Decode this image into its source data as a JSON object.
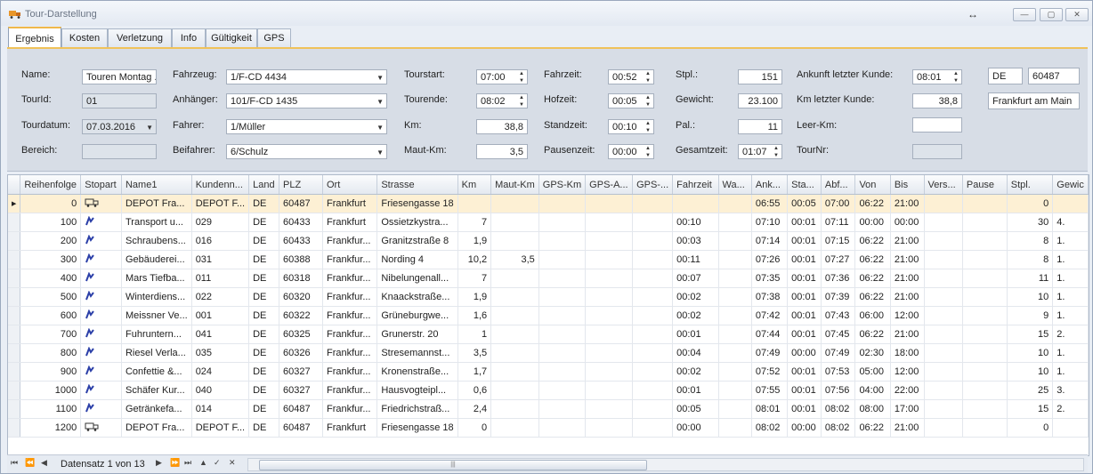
{
  "window": {
    "title": "Tour-Darstellung",
    "resize_glyph": "↔",
    "buttons": [
      "—",
      "▢",
      "✕"
    ]
  },
  "tabs": [
    "Ergebnis",
    "Kosten",
    "Verletzung",
    "Info",
    "Gültigkeit",
    "GPS"
  ],
  "form": {
    "name": {
      "label": "Name:",
      "value": "Touren Montag ..."
    },
    "tourid": {
      "label": "TourId:",
      "value": "01"
    },
    "tourdatum": {
      "label": "Tourdatum:",
      "value": "07.03.2016"
    },
    "bereich": {
      "label": "Bereich:",
      "value": ""
    },
    "fahrzeug": {
      "label": "Fahrzeug:",
      "value": "1/F-CD 4434"
    },
    "anhaenger": {
      "label": "Anhänger:",
      "value": "101/F-CD 1435"
    },
    "fahrer": {
      "label": "Fahrer:",
      "value": "1/Müller"
    },
    "beifahrer": {
      "label": "Beifahrer:",
      "value": "6/Schulz"
    },
    "tourstart": {
      "label": "Tourstart:",
      "value": "07:00"
    },
    "tourende": {
      "label": "Tourende:",
      "value": "08:02"
    },
    "km": {
      "label": "Km:",
      "value": "38,8"
    },
    "mautkm": {
      "label": "Maut-Km:",
      "value": "3,5"
    },
    "fahrzeit": {
      "label": "Fahrzeit:",
      "value": "00:52"
    },
    "hofzeit": {
      "label": "Hofzeit:",
      "value": "00:05"
    },
    "standzeit": {
      "label": "Standzeit:",
      "value": "00:10"
    },
    "pausenzeit": {
      "label": "Pausenzeit:",
      "value": "00:00"
    },
    "stpl": {
      "label": "Stpl.:",
      "value": "151"
    },
    "gewicht": {
      "label": "Gewicht:",
      "value": "23.100"
    },
    "pal": {
      "label": "Pal.:",
      "value": "11"
    },
    "gesamtzeit": {
      "label": "Gesamtzeit:",
      "value": "01:07"
    },
    "ankunft": {
      "label": "Ankunft letzter Kunde:",
      "value": "08:01"
    },
    "kmletzter": {
      "label": "Km letzter Kunde:",
      "value": "38,8"
    },
    "leerkm": {
      "label": "Leer-Km:",
      "value": ""
    },
    "tournr": {
      "label": "TourNr:",
      "value": ""
    },
    "land": "DE",
    "plz": "60487",
    "ort": "Frankfurt am Main"
  },
  "grid": {
    "columns": [
      "Reihenfolge",
      "Stopart",
      "Name1",
      "Kundenn...",
      "Land",
      "PLZ",
      "Ort",
      "Strasse",
      "Km",
      "Maut-Km",
      "GPS-Km",
      "GPS-A...",
      "GPS-...",
      "Fahrzeit",
      "Wa...",
      "Ank...",
      "Sta...",
      "Abf...",
      "Von",
      "Bis",
      "Vers...",
      "Pause",
      "Stpl.",
      "Gewic"
    ],
    "rows": [
      {
        "reihenfolge": "0",
        "stopart": "depot",
        "name1": "DEPOT Fra...",
        "kunde": "DEPOT F...",
        "land": "DE",
        "plz": "60487",
        "ort": "Frankfurt",
        "strasse": "Friesengasse 18",
        "km": "",
        "mautkm": "",
        "fahrzeit": "",
        "ank": "06:55",
        "sta": "00:05",
        "abf": "07:00",
        "von": "06:22",
        "bis": "21:00",
        "stpl": "0",
        "gew": ""
      },
      {
        "reihenfolge": "100",
        "stopart": "customer",
        "name1": "Transport u...",
        "kunde": "029",
        "land": "DE",
        "plz": "60433",
        "ort": "Frankfurt",
        "strasse": "Ossietzkystra...",
        "km": "7",
        "mautkm": "",
        "fahrzeit": "00:10",
        "ank": "07:10",
        "sta": "00:01",
        "abf": "07:11",
        "von": "00:00",
        "bis": "00:00",
        "stpl": "30",
        "gew": "4."
      },
      {
        "reihenfolge": "200",
        "stopart": "customer",
        "name1": "Schraubens...",
        "kunde": "016",
        "land": "DE",
        "plz": "60433",
        "ort": "Frankfur...",
        "strasse": "Granitzstraße 8",
        "km": "1,9",
        "mautkm": "",
        "fahrzeit": "00:03",
        "ank": "07:14",
        "sta": "00:01",
        "abf": "07:15",
        "von": "06:22",
        "bis": "21:00",
        "stpl": "8",
        "gew": "1."
      },
      {
        "reihenfolge": "300",
        "stopart": "customer",
        "name1": "Gebäuderei...",
        "kunde": "031",
        "land": "DE",
        "plz": "60388",
        "ort": "Frankfur...",
        "strasse": "Nording 4",
        "km": "10,2",
        "mautkm": "3,5",
        "fahrzeit": "00:11",
        "ank": "07:26",
        "sta": "00:01",
        "abf": "07:27",
        "von": "06:22",
        "bis": "21:00",
        "stpl": "8",
        "gew": "1."
      },
      {
        "reihenfolge": "400",
        "stopart": "customer",
        "name1": "Mars Tiefba...",
        "kunde": "011",
        "land": "DE",
        "plz": "60318",
        "ort": "Frankfur...",
        "strasse": "Nibelungenall...",
        "km": "7",
        "mautkm": "",
        "fahrzeit": "00:07",
        "ank": "07:35",
        "sta": "00:01",
        "abf": "07:36",
        "von": "06:22",
        "bis": "21:00",
        "stpl": "11",
        "gew": "1."
      },
      {
        "reihenfolge": "500",
        "stopart": "customer",
        "name1": "Winterdiens...",
        "kunde": "022",
        "land": "DE",
        "plz": "60320",
        "ort": "Frankfur...",
        "strasse": "Knaackstraße...",
        "km": "1,9",
        "mautkm": "",
        "fahrzeit": "00:02",
        "ank": "07:38",
        "sta": "00:01",
        "abf": "07:39",
        "von": "06:22",
        "bis": "21:00",
        "stpl": "10",
        "gew": "1."
      },
      {
        "reihenfolge": "600",
        "stopart": "customer",
        "name1": "Meissner Ve...",
        "kunde": "001",
        "land": "DE",
        "plz": "60322",
        "ort": "Frankfur...",
        "strasse": "Grüneburgwe...",
        "km": "1,6",
        "mautkm": "",
        "fahrzeit": "00:02",
        "ank": "07:42",
        "sta": "00:01",
        "abf": "07:43",
        "von": "06:00",
        "bis": "12:00",
        "stpl": "9",
        "gew": "1."
      },
      {
        "reihenfolge": "700",
        "stopart": "customer",
        "name1": "Fuhruntern...",
        "kunde": "041",
        "land": "DE",
        "plz": "60325",
        "ort": "Frankfur...",
        "strasse": "Grunerstr. 20",
        "km": "1",
        "mautkm": "",
        "fahrzeit": "00:01",
        "ank": "07:44",
        "sta": "00:01",
        "abf": "07:45",
        "von": "06:22",
        "bis": "21:00",
        "stpl": "15",
        "gew": "2."
      },
      {
        "reihenfolge": "800",
        "stopart": "customer",
        "name1": "Riesel Verla...",
        "kunde": "035",
        "land": "DE",
        "plz": "60326",
        "ort": "Frankfur...",
        "strasse": "Stresemannst...",
        "km": "3,5",
        "mautkm": "",
        "fahrzeit": "00:04",
        "ank": "07:49",
        "sta": "00:00",
        "abf": "07:49",
        "von": "02:30",
        "bis": "18:00",
        "stpl": "10",
        "gew": "1."
      },
      {
        "reihenfolge": "900",
        "stopart": "customer",
        "name1": "Confettie &...",
        "kunde": "024",
        "land": "DE",
        "plz": "60327",
        "ort": "Frankfur...",
        "strasse": "Kronenstraße...",
        "km": "1,7",
        "mautkm": "",
        "fahrzeit": "00:02",
        "ank": "07:52",
        "sta": "00:01",
        "abf": "07:53",
        "von": "05:00",
        "bis": "12:00",
        "stpl": "10",
        "gew": "1."
      },
      {
        "reihenfolge": "1000",
        "stopart": "customer",
        "name1": "Schäfer Kur...",
        "kunde": "040",
        "land": "DE",
        "plz": "60327",
        "ort": "Frankfur...",
        "strasse": "Hausvogteipl...",
        "km": "0,6",
        "mautkm": "",
        "fahrzeit": "00:01",
        "ank": "07:55",
        "sta": "00:01",
        "abf": "07:56",
        "von": "04:00",
        "bis": "22:00",
        "stpl": "25",
        "gew": "3."
      },
      {
        "reihenfolge": "1100",
        "stopart": "customer",
        "name1": "Getränkefa...",
        "kunde": "014",
        "land": "DE",
        "plz": "60487",
        "ort": "Frankfur...",
        "strasse": "Friedrichstraß...",
        "km": "2,4",
        "mautkm": "",
        "fahrzeit": "00:05",
        "ank": "08:01",
        "sta": "00:01",
        "abf": "08:02",
        "von": "08:00",
        "bis": "17:00",
        "stpl": "15",
        "gew": "2."
      },
      {
        "reihenfolge": "1200",
        "stopart": "depot",
        "name1": "DEPOT Fra...",
        "kunde": "DEPOT F...",
        "land": "DE",
        "plz": "60487",
        "ort": "Frankfurt",
        "strasse": "Friesengasse 18",
        "km": "0",
        "mautkm": "",
        "fahrzeit": "00:00",
        "ank": "08:02",
        "sta": "00:00",
        "abf": "08:02",
        "von": "06:22",
        "bis": "21:00",
        "stpl": "0",
        "gew": ""
      }
    ]
  },
  "navigator": {
    "record_text": "Datensatz 1 von 13"
  },
  "colors": {
    "accent": "#f0c25a",
    "selected_row": "#fdf0d4",
    "customer_icon": "#2b3fa8"
  },
  "icons": {
    "depot": "truck-icon",
    "customer": "route-stop-icon"
  }
}
